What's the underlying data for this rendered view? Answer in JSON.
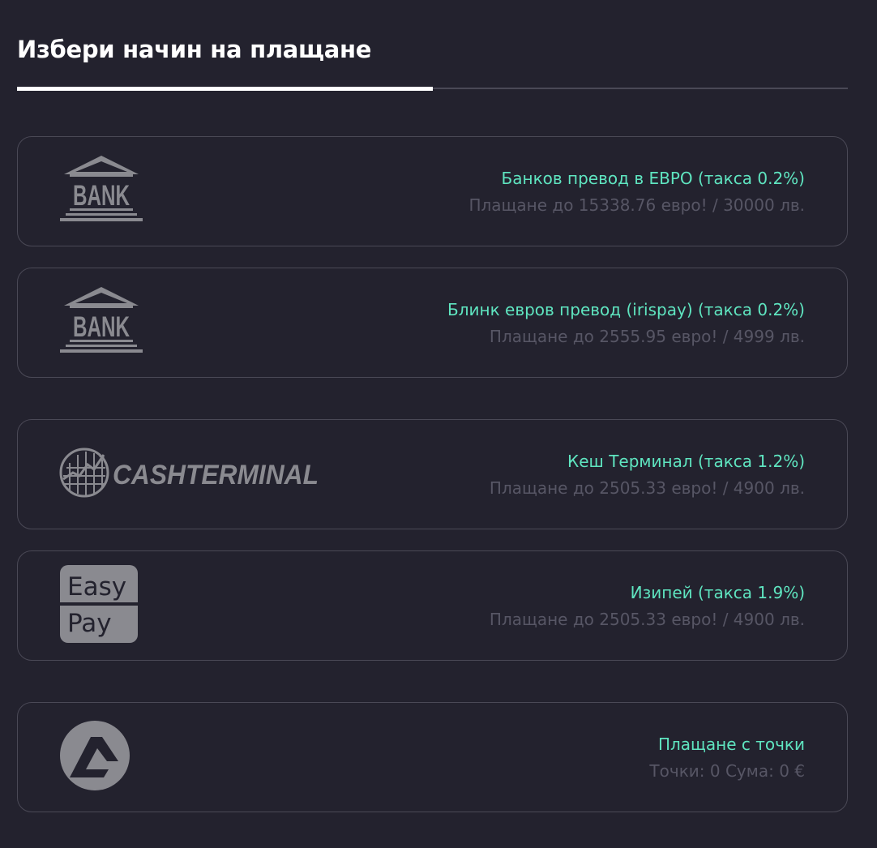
{
  "header": {
    "title": "Избери начин на плащане",
    "step_progress": 0.5
  },
  "colors": {
    "background": "#23222e",
    "method_name": "#5fe5c0",
    "limit_text": "#575665",
    "border": "#4a4956",
    "logo_gray": "#8a8a90"
  },
  "methods": [
    {
      "name": "Банков превод в ЕВРО (такса 0.2%)",
      "limit": "Плащане до 15338.76 евро! / 30000 лв.",
      "logo": {
        "icon": "bank-icon",
        "text": "BANK"
      }
    },
    {
      "name": "Блинк евров превод (irispay) (такса 0.2%)",
      "limit": "Плащане до 2555.95 евро! / 4999 лв.",
      "logo": {
        "icon": "bank-icon",
        "text": "BANK"
      }
    },
    {
      "name": "Кеш Терминал (такса 1.2%)",
      "limit": "Плащане до 2505.33 евро! / 4900 лв.",
      "logo": {
        "icon": "cashterminal-logo",
        "text": "CASHTERMINAL"
      }
    },
    {
      "name": "Изипей (такса 1.9%)",
      "limit": "Плащане до 2505.33 евро! / 4900 лв.",
      "logo": {
        "icon": "easypay-logo",
        "text_top": "Easy",
        "text_bottom": "Pay"
      }
    },
    {
      "name": "Плащане с точки",
      "limit": "Точки: 0 Сума: 0 €",
      "logo": {
        "icon": "points-logo"
      }
    }
  ]
}
